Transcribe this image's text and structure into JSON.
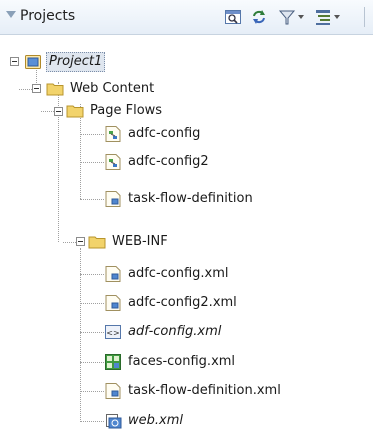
{
  "panel": {
    "title": "Projects"
  },
  "toolbar": [
    {
      "name": "navigator-icon",
      "dropdown": false
    },
    {
      "name": "sync-icon",
      "dropdown": false
    },
    {
      "name": "filter-icon",
      "dropdown": true
    },
    {
      "name": "layout-icon",
      "dropdown": true
    }
  ],
  "tree": {
    "project": {
      "label": "Project1"
    },
    "web_content": {
      "label": "Web Content"
    },
    "page_flows": {
      "label": "Page Flows",
      "items": [
        "adfc-config",
        "adfc-config2",
        "task-flow-definition"
      ]
    },
    "web_inf": {
      "label": "WEB-INF",
      "items": [
        "adfc-config.xml",
        "adfc-config2.xml",
        "adf-config.xml",
        "faces-config.xml",
        "task-flow-definition.xml",
        "web.xml"
      ]
    }
  },
  "colors": {
    "folder": "#f2d36b",
    "project": "#5b8fd6",
    "header_bg": "#e6eef7"
  }
}
